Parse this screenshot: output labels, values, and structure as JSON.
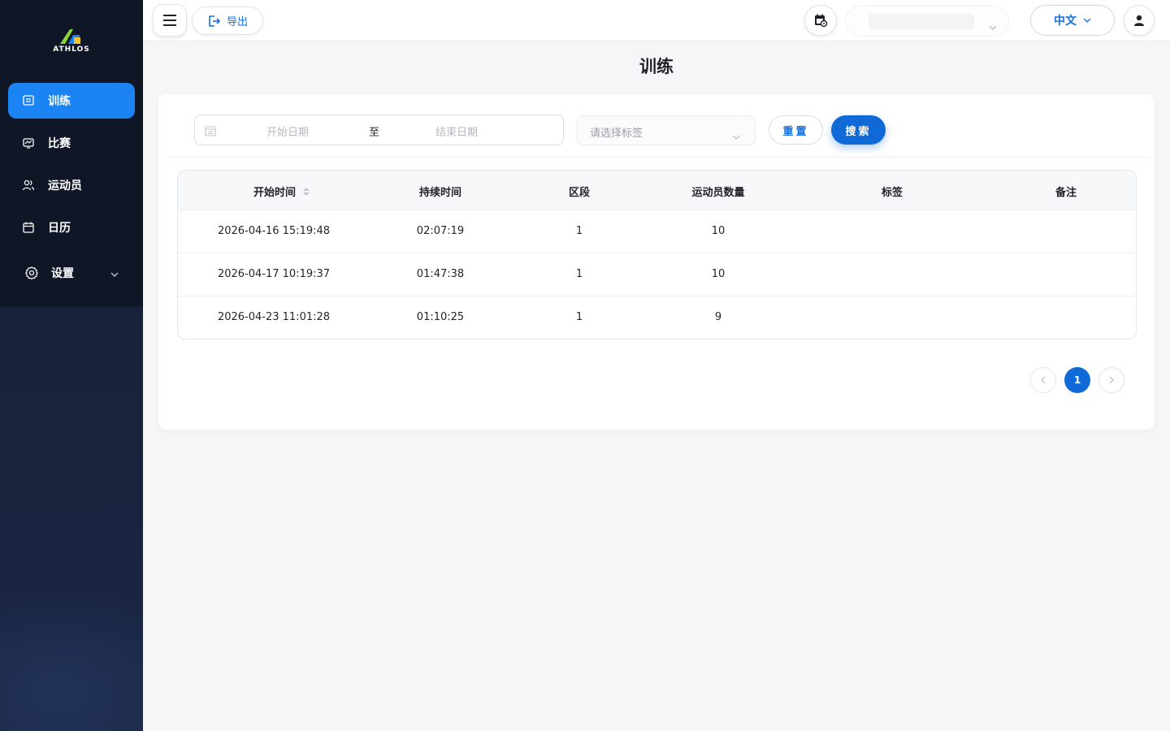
{
  "app": {
    "logo_text": "ATHLOS"
  },
  "sidebar": {
    "items": [
      {
        "label": "训练",
        "icon": "training-icon",
        "active": true
      },
      {
        "label": "比赛",
        "icon": "match-icon",
        "active": false
      },
      {
        "label": "运动员",
        "icon": "athletes-icon",
        "active": false
      },
      {
        "label": "日历",
        "icon": "calendar-icon",
        "active": false
      },
      {
        "label": "设置",
        "icon": "gear-icon",
        "active": false,
        "expandable": true
      }
    ]
  },
  "header": {
    "export_label": "导出",
    "language_label": "中文"
  },
  "page": {
    "title": "训练"
  },
  "filters": {
    "start_placeholder": "开始日期",
    "range_separator": "至",
    "end_placeholder": "结束日期",
    "tag_placeholder": "请选择标签",
    "reset_label": "重置",
    "search_label": "搜索"
  },
  "table": {
    "columns": [
      "开始时间",
      "持续时间",
      "区段",
      "运动员数量",
      "标签",
      "备注"
    ],
    "rows": [
      [
        "2026-04-16 15:19:48",
        "02:07:19",
        "1",
        "10",
        "",
        ""
      ],
      [
        "2026-04-17 10:19:37",
        "01:47:38",
        "1",
        "10",
        "",
        ""
      ],
      [
        "2026-04-23 11:01:28",
        "01:10:25",
        "1",
        "9",
        "",
        ""
      ]
    ]
  },
  "pagination": {
    "current_page": "1"
  },
  "colors": {
    "accent": "#1c84f2",
    "primary_button": "#0f6ad8",
    "sidebar_bg": "#0f1626"
  }
}
